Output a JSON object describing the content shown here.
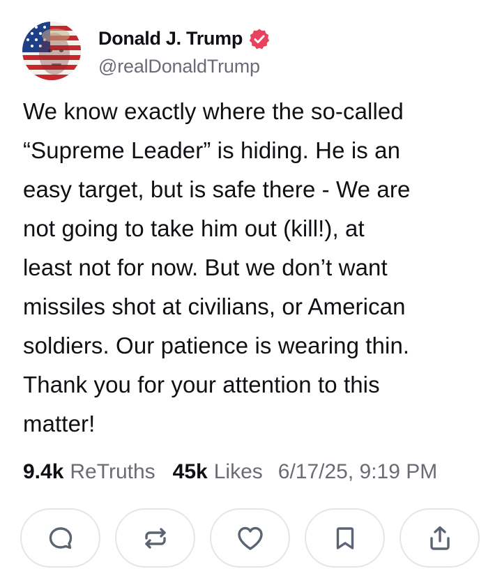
{
  "author": {
    "display_name": "Donald J. Trump",
    "handle": "@realDonaldTrump",
    "verified": true,
    "avatar_icon": "flag-portrait-avatar",
    "verified_icon": "verified-badge-icon"
  },
  "post": {
    "text": "We know exactly where the so-called\n“Supreme Leader” is hiding. He is an\neasy target, but is safe there - We are\nnot going to take him out (kill!), at\nleast not for now. But we don’t want\nmissiles shot at civilians, or American\nsoldiers. Our patience is wearing thin.\nThank you for your attention to this\nmatter!"
  },
  "stats": {
    "retruths_count": "9.4k",
    "retruths_label": "ReTruths",
    "likes_count": "45k",
    "likes_label": "Likes",
    "timestamp": "6/17/25, 9:19 PM"
  },
  "actions": [
    {
      "icon": "reply-icon"
    },
    {
      "icon": "retruth-icon"
    },
    {
      "icon": "like-icon"
    },
    {
      "icon": "bookmark-icon"
    },
    {
      "icon": "share-icon"
    }
  ],
  "colors": {
    "text": "#0f0f14",
    "muted": "#6b6b76",
    "verified_badge": "#e8435d",
    "action_icon": "#5b6472",
    "button_border": "#e6e6ea"
  }
}
